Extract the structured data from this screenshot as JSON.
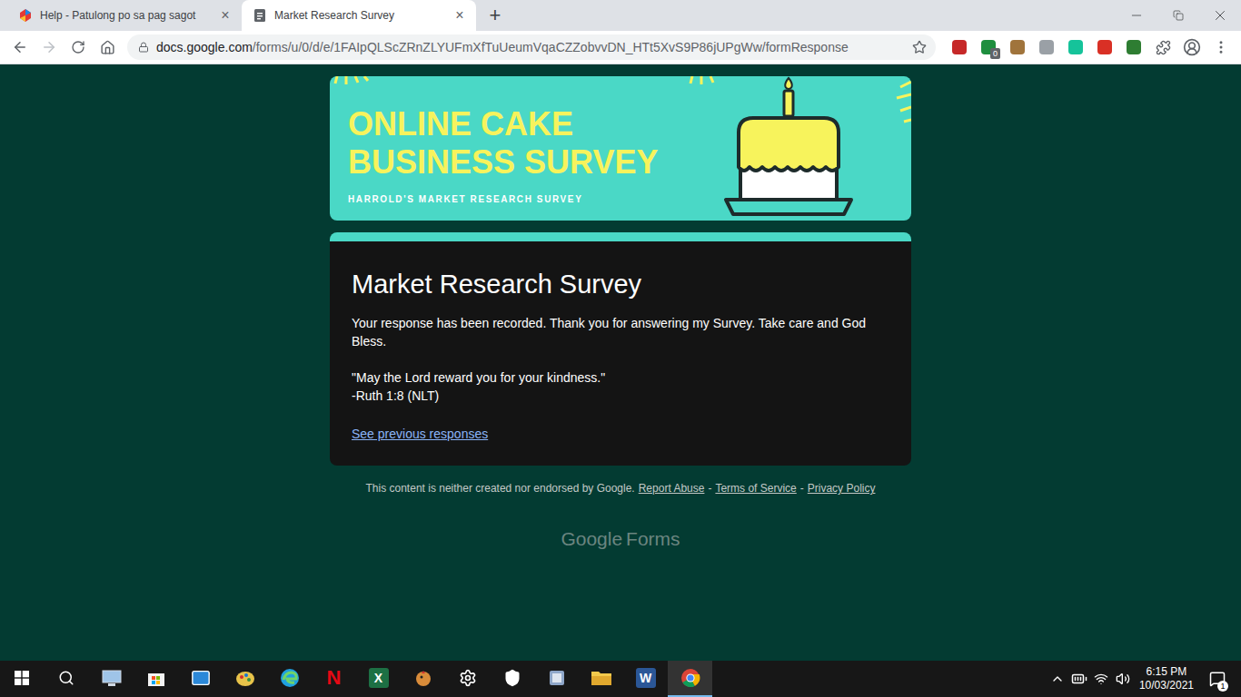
{
  "tabs": [
    {
      "label": "Help - Patulong po sa pag sagot",
      "selected": false,
      "close": "×"
    },
    {
      "label": "Market Research Survey",
      "selected": true,
      "close": "×"
    }
  ],
  "new_tab": "+",
  "address_bar": {
    "host": "docs.google.com",
    "path": "/forms/u/0/d/e/1FAIpQLScZRnZLYUFmXfTuUeumVqaCZZobvvDN_HTt5XvS9P86jUPgWw/formResponse"
  },
  "extensions": [
    {
      "color": "#c62828"
    },
    {
      "color": "#1e8e3e",
      "badge": "0"
    },
    {
      "color": "#a0743c"
    },
    {
      "color": "#9aa0a6"
    },
    {
      "color": "#15c39a"
    },
    {
      "color": "#d93025"
    },
    {
      "color": "#2e7d32"
    }
  ],
  "banner": {
    "title_lines": [
      "ONLINE CAKE",
      "BUSINESS SURVEY"
    ],
    "subtitle": "HARROLD'S MARKET RESEARCH SURVEY"
  },
  "card": {
    "title": "Market Research Survey",
    "message": "Your response has been recorded. Thank you for answering my Survey. Take care and God Bless.",
    "quote": "\"May the Lord reward you for your kindness.\"",
    "reference": "-Ruth 1:8 (NLT)",
    "link": "See previous responses"
  },
  "footer": {
    "notice": "This content is neither created nor endorsed by Google.",
    "links": [
      "Report Abuse",
      "Terms of Service",
      "Privacy Policy"
    ],
    "separator": "-"
  },
  "logo": {
    "brand": "Google",
    "product": "Forms"
  },
  "taskbar": {
    "apps": [
      {
        "kind": "pc",
        "color": "#9fc4e8",
        "running": false
      },
      {
        "kind": "store",
        "color": "#f3f3f3",
        "running": false
      },
      {
        "kind": "mail",
        "color": "#2b88d8",
        "running": false
      },
      {
        "kind": "paint",
        "color": "#e8c34a",
        "running": false
      },
      {
        "kind": "edge",
        "color": "#1fa0e0",
        "running": false
      },
      {
        "kind": "letter",
        "glyph": "N",
        "color": "#e50914",
        "running": false
      },
      {
        "kind": "tile",
        "glyph": "X",
        "color": "#1d7044",
        "running": false
      },
      {
        "kind": "game",
        "color": "#d98c3a",
        "running": false
      },
      {
        "kind": "gear",
        "color": "#ffffff",
        "running": false
      },
      {
        "kind": "shield",
        "color": "#ffffff",
        "running": false
      },
      {
        "kind": "tool",
        "color": "#8fa7c9",
        "running": false
      },
      {
        "kind": "folder",
        "color": "#f2c94c",
        "running": false
      },
      {
        "kind": "tile",
        "glyph": "W",
        "color": "#2b5797",
        "running": false
      },
      {
        "kind": "chrome",
        "color": "#db4437",
        "running": true
      }
    ],
    "time": "6:15 PM",
    "date": "10/03/2021",
    "notifications": "1"
  }
}
